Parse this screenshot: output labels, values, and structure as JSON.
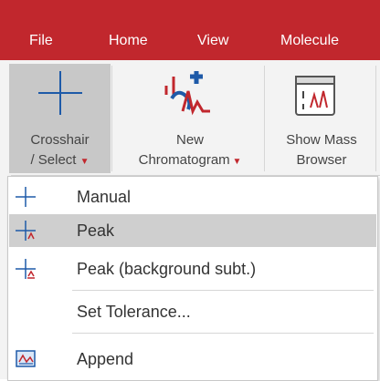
{
  "menubar": {
    "items": [
      "File",
      "Home",
      "View",
      "Molecule"
    ]
  },
  "ribbon": {
    "crosshair": {
      "line1": "Crosshair",
      "line2": "/ Select"
    },
    "new_chromatogram": {
      "line1": "New",
      "line2": "Chromatogram"
    },
    "mass_browser": {
      "line1": "Show Mass",
      "line2": "Browser"
    }
  },
  "dropdown": {
    "items": [
      {
        "label": "Manual",
        "icon": "crosshair-icon"
      },
      {
        "label": "Peak",
        "icon": "peak-crosshair-icon",
        "highlighted": true
      },
      {
        "label": "Peak (background subt.)",
        "icon": "peak-background-crosshair-icon"
      },
      {
        "label": "Set Tolerance...",
        "icon": ""
      },
      {
        "label": "Append",
        "icon": "append-icon"
      }
    ]
  },
  "colors": {
    "menubar": "#c1272d",
    "highlight": "#cfcfcf",
    "accent_blue": "#1e5aa8"
  }
}
